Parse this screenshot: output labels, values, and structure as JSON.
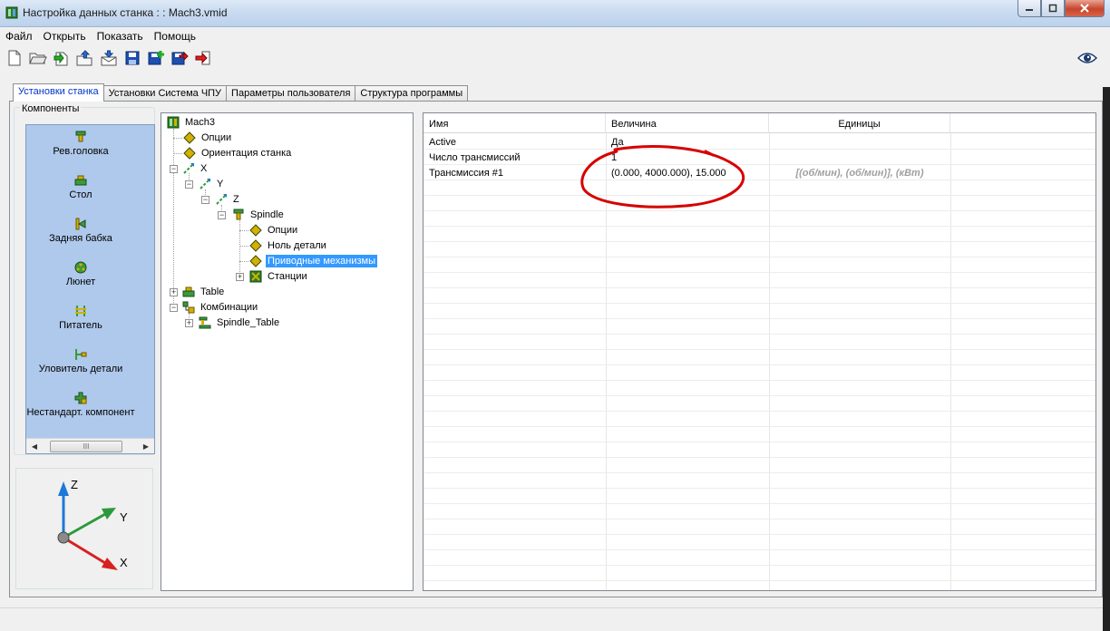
{
  "window": {
    "title": "Настройка данных станка : : Mach3.vmid",
    "controls": {
      "minimize": "minimize-icon",
      "maximize": "maximize-icon",
      "close": "close-icon"
    }
  },
  "menu": [
    "Файл",
    "Открыть",
    "Показать",
    "Помощь"
  ],
  "toolbar": {
    "icons": [
      "new-file-icon",
      "open-folder-icon",
      "import-icon",
      "open-upload-icon",
      "export-mail-icon",
      "save-icon",
      "save-add-icon",
      "save-as-icon",
      "exit-icon"
    ],
    "view_icon": "eye-icon"
  },
  "tabs": [
    "Установки станка",
    "Установки Система ЧПУ",
    "Параметры пользователя",
    "Структура программы"
  ],
  "components": {
    "group_label": "Компоненты",
    "items": [
      {
        "label": "Рев.головка",
        "icon": "turret-icon"
      },
      {
        "label": "Стол",
        "icon": "table-icon"
      },
      {
        "label": "Задняя бабка",
        "icon": "tailstock-icon"
      },
      {
        "label": "Люнет",
        "icon": "steady-rest-icon"
      },
      {
        "label": "Питатель",
        "icon": "feeder-icon"
      },
      {
        "label": "Уловитель детали",
        "icon": "part-catcher-icon"
      },
      {
        "label": "Нестандарт. компонент",
        "icon": "custom-component-icon"
      }
    ],
    "scroll_thumb": "III"
  },
  "axes": {
    "z": "Z",
    "y": "Y",
    "x": "X"
  },
  "tree": [
    {
      "label": "Mach3",
      "icon": "machine-icon"
    },
    {
      "label": "Опции",
      "icon": "diamond-icon"
    },
    {
      "label": "Ориентация станка",
      "icon": "diamond-icon"
    },
    {
      "label": "X",
      "icon": "axis-icon"
    },
    {
      "label": "Y",
      "icon": "axis-icon"
    },
    {
      "label": "Z",
      "icon": "axis-icon"
    },
    {
      "label": "Spindle",
      "icon": "spindle-icon"
    },
    {
      "label": "Опции",
      "icon": "diamond-icon"
    },
    {
      "label": "Ноль детали",
      "icon": "diamond-icon"
    },
    {
      "label": "Приводные механизмы",
      "icon": "diamond-icon",
      "selected": true
    },
    {
      "label": "Станции",
      "icon": "stations-icon"
    },
    {
      "label": "Table",
      "icon": "table-icon"
    },
    {
      "label": "Комбинации",
      "icon": "combinations-icon"
    },
    {
      "label": "Spindle_Table",
      "icon": "spindle-table-icon"
    }
  ],
  "grid": {
    "columns": [
      "Имя",
      "Величина",
      "Единицы"
    ],
    "rows": [
      {
        "name": "Active",
        "value": "Да",
        "units": ""
      },
      {
        "name": "Число трансмиссий",
        "value": "1",
        "units": ""
      },
      {
        "name": "Трансмиссия #1",
        "value": "(0.000, 4000.000), 15.000",
        "units": "[(об/мин), (об/мин)], (кВт)"
      }
    ]
  },
  "colors": {
    "selection": "#3399ff",
    "component_panel": "#afc9ec",
    "annotation": "#d60000",
    "active_tab_text": "#0033cc"
  }
}
